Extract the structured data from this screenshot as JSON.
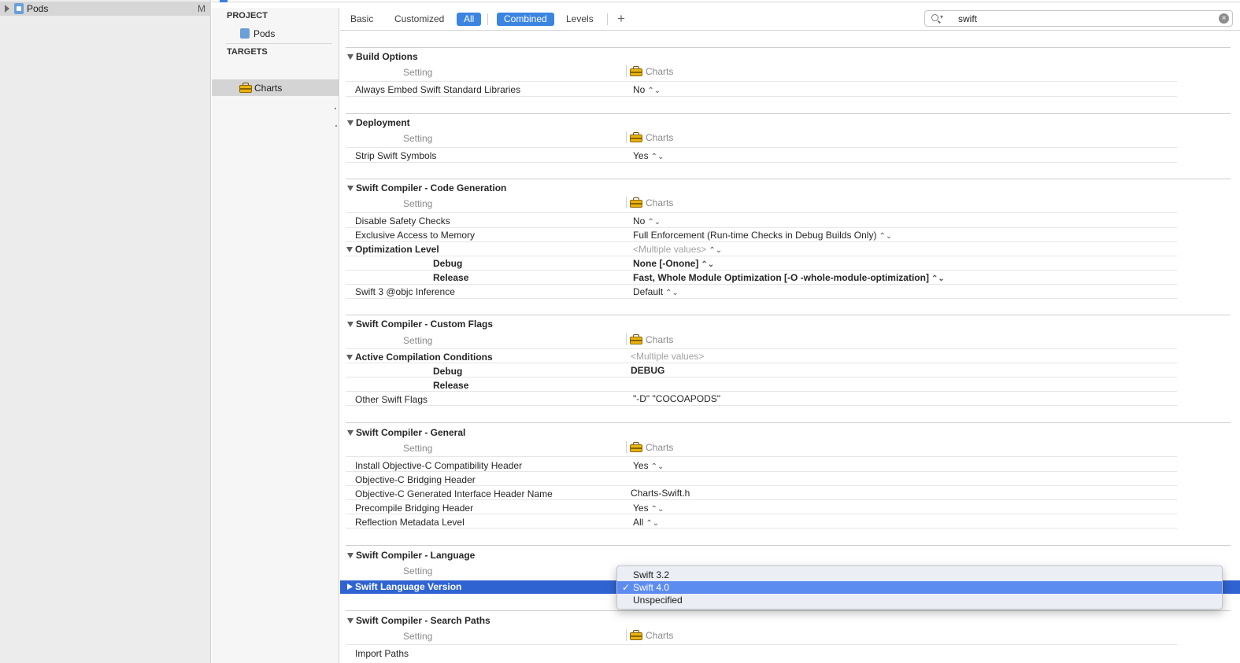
{
  "navigator": {
    "root_item": "Pods",
    "root_badge": "M"
  },
  "target_list": {
    "project_header": "PROJECT",
    "project_item": "Pods",
    "targets_header": "TARGETS",
    "target_item": "Charts"
  },
  "filter_bar": {
    "basic": "Basic",
    "customized": "Customized",
    "all": "All",
    "combined": "Combined",
    "levels": "Levels",
    "add": "+",
    "search_value": "swift",
    "clear": "×"
  },
  "columns": {
    "setting": "Setting",
    "target": "Charts"
  },
  "groups": {
    "build_options": {
      "title": "Build Options",
      "rows": [
        {
          "label": "Always Embed Swift Standard Libraries",
          "value": "No"
        }
      ]
    },
    "deployment": {
      "title": "Deployment",
      "rows": [
        {
          "label": "Strip Swift Symbols",
          "value": "Yes"
        }
      ]
    },
    "code_generation": {
      "title": "Swift Compiler - Code Generation",
      "disable_safety_checks": {
        "label": "Disable Safety Checks",
        "value": "No"
      },
      "exclusive_access": {
        "label": "Exclusive Access to Memory",
        "value": "Full Enforcement (Run-time Checks in Debug Builds Only)"
      },
      "optimization": {
        "label": "Optimization Level",
        "value": "<Multiple values>"
      },
      "opt_debug": {
        "label": "Debug",
        "value": "None [-Onone]"
      },
      "opt_release": {
        "label": "Release",
        "value": "Fast, Whole Module Optimization  [-O -whole-module-optimization]"
      },
      "objc_inference": {
        "label": "Swift 3 @objc Inference",
        "value": "Default"
      }
    },
    "custom_flags": {
      "title": "Swift Compiler - Custom Flags",
      "active_conditions": {
        "label": "Active Compilation Conditions",
        "value": "<Multiple values>"
      },
      "cond_debug": {
        "label": "Debug",
        "value": "DEBUG"
      },
      "cond_release": {
        "label": "Release",
        "value": ""
      },
      "other_flags": {
        "label": "Other Swift Flags",
        "value": "\"-D\" \"COCOAPODS\""
      }
    },
    "general": {
      "title": "Swift Compiler - General",
      "install_objc_header": {
        "label": "Install Objective-C Compatibility Header",
        "value": "Yes"
      },
      "bridging_header": {
        "label": "Objective-C Bridging Header",
        "value": ""
      },
      "generated_header": {
        "label": "Objective-C Generated Interface Header Name",
        "value": "Charts-Swift.h"
      },
      "precompile": {
        "label": "Precompile Bridging Header",
        "value": "Yes"
      },
      "reflection": {
        "label": "Reflection Metadata Level",
        "value": "All"
      }
    },
    "language": {
      "title": "Swift Compiler - Language",
      "version_row": {
        "label": "Swift Language Version"
      }
    },
    "search_paths": {
      "title": "Swift Compiler - Search Paths",
      "import_paths": {
        "label": "Import Paths"
      }
    }
  },
  "popup_menu": {
    "items": [
      "Swift 3.2",
      "Swift 4.0",
      "Unspecified"
    ],
    "selected": "Swift 4.0",
    "check": "✓"
  },
  "icons": {
    "stepper": "⌃⌄",
    "project_icon": "project-file-icon",
    "target_icon": "toolbox-icon"
  },
  "colors": {
    "accent": "#3b85e0",
    "selection": "#2f63d2",
    "menu_highlight": "#5d8cf0"
  }
}
